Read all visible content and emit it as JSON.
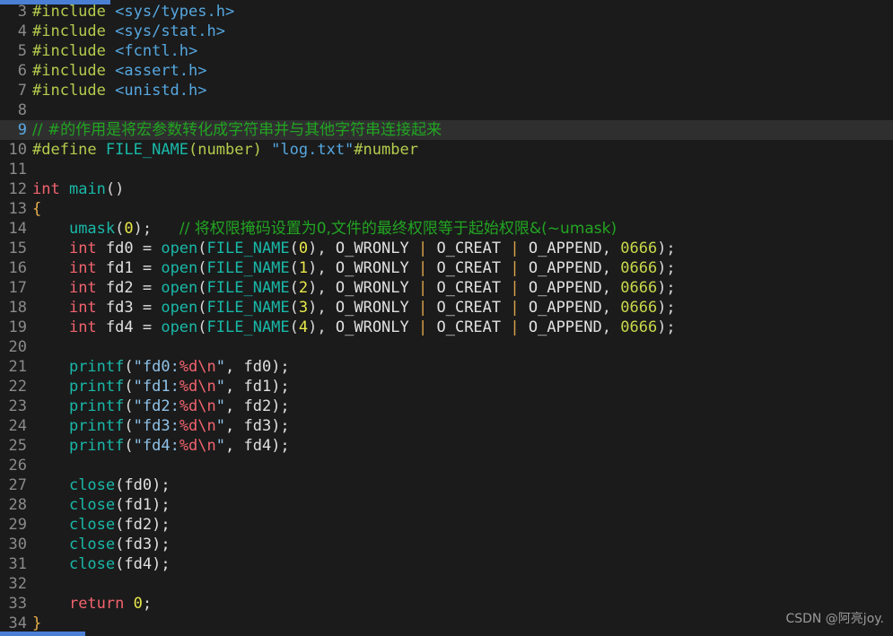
{
  "editor": {
    "background": "#1b1b1b",
    "active_line_background": "#2f2f2f",
    "gutter_color": "#8a8a8a",
    "active_gutter_color": "#5aa9e6",
    "scrollbar_color": "#4a7fd4",
    "first_visible_line": 3,
    "last_visible_line": 34,
    "active_line": 9
  },
  "watermark": {
    "text": "CSDN @阿亮joy."
  },
  "lines": [
    {
      "n": "3",
      "active": false,
      "tokens": [
        {
          "t": "#include",
          "c": "t-pre"
        },
        {
          "t": " ",
          "c": "t-plain"
        },
        {
          "t": "<sys/types.h>",
          "c": "t-header"
        }
      ]
    },
    {
      "n": "4",
      "active": false,
      "tokens": [
        {
          "t": "#include",
          "c": "t-pre"
        },
        {
          "t": " ",
          "c": "t-plain"
        },
        {
          "t": "<sys/stat.h>",
          "c": "t-header"
        }
      ]
    },
    {
      "n": "5",
      "active": false,
      "tokens": [
        {
          "t": "#include",
          "c": "t-pre"
        },
        {
          "t": " ",
          "c": "t-plain"
        },
        {
          "t": "<fcntl.h>",
          "c": "t-header"
        }
      ]
    },
    {
      "n": "6",
      "active": false,
      "tokens": [
        {
          "t": "#include",
          "c": "t-pre"
        },
        {
          "t": " ",
          "c": "t-plain"
        },
        {
          "t": "<assert.h>",
          "c": "t-header"
        }
      ]
    },
    {
      "n": "7",
      "active": false,
      "tokens": [
        {
          "t": "#include",
          "c": "t-pre"
        },
        {
          "t": " ",
          "c": "t-plain"
        },
        {
          "t": "<unistd.h>",
          "c": "t-header"
        }
      ]
    },
    {
      "n": "8",
      "active": false,
      "tokens": []
    },
    {
      "n": "9",
      "active": true,
      "tokens": [
        {
          "t": "// #的作用是将宏参数转化成字符串并与其他字符串连接起来",
          "c": "t-comment cjk"
        }
      ]
    },
    {
      "n": "10",
      "active": false,
      "tokens": [
        {
          "t": "#define",
          "c": "t-pre"
        },
        {
          "t": " ",
          "c": "t-plain"
        },
        {
          "t": "FILE_NAME",
          "c": "t-fn"
        },
        {
          "t": "(number)",
          "c": "t-pre"
        },
        {
          "t": " ",
          "c": "t-plain"
        },
        {
          "t": "\"log.txt\"",
          "c": "t-header"
        },
        {
          "t": "#number",
          "c": "t-pre"
        }
      ]
    },
    {
      "n": "11",
      "active": false,
      "tokens": []
    },
    {
      "n": "12",
      "active": false,
      "tokens": [
        {
          "t": "int",
          "c": "t-kw"
        },
        {
          "t": " ",
          "c": "t-plain"
        },
        {
          "t": "main",
          "c": "t-fn"
        },
        {
          "t": "()",
          "c": "t-punct"
        }
      ]
    },
    {
      "n": "13",
      "active": false,
      "tokens": [
        {
          "t": "{",
          "c": "t-brace"
        }
      ]
    },
    {
      "n": "14",
      "active": false,
      "tokens": [
        {
          "t": "    ",
          "c": "t-plain"
        },
        {
          "t": "umask",
          "c": "t-fn"
        },
        {
          "t": "(",
          "c": "t-punct"
        },
        {
          "t": "0",
          "c": "t-num"
        },
        {
          "t": ");",
          "c": "t-punct"
        },
        {
          "t": "   ",
          "c": "t-plain"
        },
        {
          "t": "// 将权限掩码设置为0,文件的最终权限等于起始权限&(~umask)",
          "c": "t-comment cjk"
        }
      ]
    },
    {
      "n": "15",
      "active": false,
      "tokens": [
        {
          "t": "    ",
          "c": "t-plain"
        },
        {
          "t": "int",
          "c": "t-kw"
        },
        {
          "t": " fd0 = ",
          "c": "t-plain"
        },
        {
          "t": "open",
          "c": "t-fn"
        },
        {
          "t": "(",
          "c": "t-punct"
        },
        {
          "t": "FILE_NAME",
          "c": "t-fn"
        },
        {
          "t": "(",
          "c": "t-punct"
        },
        {
          "t": "0",
          "c": "t-num"
        },
        {
          "t": "), ",
          "c": "t-punct"
        },
        {
          "t": "O_WRONLY",
          "c": "t-flag"
        },
        {
          "t": " | ",
          "c": "t-pipe"
        },
        {
          "t": "O_CREAT",
          "c": "t-flag"
        },
        {
          "t": " | ",
          "c": "t-pipe"
        },
        {
          "t": "O_APPEND",
          "c": "t-flag"
        },
        {
          "t": ", ",
          "c": "t-punct"
        },
        {
          "t": "0666",
          "c": "t-octal"
        },
        {
          "t": ");",
          "c": "t-punct"
        }
      ]
    },
    {
      "n": "16",
      "active": false,
      "tokens": [
        {
          "t": "    ",
          "c": "t-plain"
        },
        {
          "t": "int",
          "c": "t-kw"
        },
        {
          "t": " fd1 = ",
          "c": "t-plain"
        },
        {
          "t": "open",
          "c": "t-fn"
        },
        {
          "t": "(",
          "c": "t-punct"
        },
        {
          "t": "FILE_NAME",
          "c": "t-fn"
        },
        {
          "t": "(",
          "c": "t-punct"
        },
        {
          "t": "1",
          "c": "t-num"
        },
        {
          "t": "), ",
          "c": "t-punct"
        },
        {
          "t": "O_WRONLY",
          "c": "t-flag"
        },
        {
          "t": " | ",
          "c": "t-pipe"
        },
        {
          "t": "O_CREAT",
          "c": "t-flag"
        },
        {
          "t": " | ",
          "c": "t-pipe"
        },
        {
          "t": "O_APPEND",
          "c": "t-flag"
        },
        {
          "t": ", ",
          "c": "t-punct"
        },
        {
          "t": "0666",
          "c": "t-octal"
        },
        {
          "t": ");",
          "c": "t-punct"
        }
      ]
    },
    {
      "n": "17",
      "active": false,
      "tokens": [
        {
          "t": "    ",
          "c": "t-plain"
        },
        {
          "t": "int",
          "c": "t-kw"
        },
        {
          "t": " fd2 = ",
          "c": "t-plain"
        },
        {
          "t": "open",
          "c": "t-fn"
        },
        {
          "t": "(",
          "c": "t-punct"
        },
        {
          "t": "FILE_NAME",
          "c": "t-fn"
        },
        {
          "t": "(",
          "c": "t-punct"
        },
        {
          "t": "2",
          "c": "t-num"
        },
        {
          "t": "), ",
          "c": "t-punct"
        },
        {
          "t": "O_WRONLY",
          "c": "t-flag"
        },
        {
          "t": " | ",
          "c": "t-pipe"
        },
        {
          "t": "O_CREAT",
          "c": "t-flag"
        },
        {
          "t": " | ",
          "c": "t-pipe"
        },
        {
          "t": "O_APPEND",
          "c": "t-flag"
        },
        {
          "t": ", ",
          "c": "t-punct"
        },
        {
          "t": "0666",
          "c": "t-octal"
        },
        {
          "t": ");",
          "c": "t-punct"
        }
      ]
    },
    {
      "n": "18",
      "active": false,
      "tokens": [
        {
          "t": "    ",
          "c": "t-plain"
        },
        {
          "t": "int",
          "c": "t-kw"
        },
        {
          "t": " fd3 = ",
          "c": "t-plain"
        },
        {
          "t": "open",
          "c": "t-fn"
        },
        {
          "t": "(",
          "c": "t-punct"
        },
        {
          "t": "FILE_NAME",
          "c": "t-fn"
        },
        {
          "t": "(",
          "c": "t-punct"
        },
        {
          "t": "3",
          "c": "t-num"
        },
        {
          "t": "), ",
          "c": "t-punct"
        },
        {
          "t": "O_WRONLY",
          "c": "t-flag"
        },
        {
          "t": " | ",
          "c": "t-pipe"
        },
        {
          "t": "O_CREAT",
          "c": "t-flag"
        },
        {
          "t": " | ",
          "c": "t-pipe"
        },
        {
          "t": "O_APPEND",
          "c": "t-flag"
        },
        {
          "t": ", ",
          "c": "t-punct"
        },
        {
          "t": "0666",
          "c": "t-octal"
        },
        {
          "t": ");",
          "c": "t-punct"
        }
      ]
    },
    {
      "n": "19",
      "active": false,
      "tokens": [
        {
          "t": "    ",
          "c": "t-plain"
        },
        {
          "t": "int",
          "c": "t-kw"
        },
        {
          "t": " fd4 = ",
          "c": "t-plain"
        },
        {
          "t": "open",
          "c": "t-fn"
        },
        {
          "t": "(",
          "c": "t-punct"
        },
        {
          "t": "FILE_NAME",
          "c": "t-fn"
        },
        {
          "t": "(",
          "c": "t-punct"
        },
        {
          "t": "4",
          "c": "t-num"
        },
        {
          "t": "), ",
          "c": "t-punct"
        },
        {
          "t": "O_WRONLY",
          "c": "t-flag"
        },
        {
          "t": " | ",
          "c": "t-pipe"
        },
        {
          "t": "O_CREAT",
          "c": "t-flag"
        },
        {
          "t": " | ",
          "c": "t-pipe"
        },
        {
          "t": "O_APPEND",
          "c": "t-flag"
        },
        {
          "t": ", ",
          "c": "t-punct"
        },
        {
          "t": "0666",
          "c": "t-octal"
        },
        {
          "t": ");",
          "c": "t-punct"
        }
      ]
    },
    {
      "n": "20",
      "active": false,
      "tokens": []
    },
    {
      "n": "21",
      "active": false,
      "tokens": [
        {
          "t": "    ",
          "c": "t-plain"
        },
        {
          "t": "printf",
          "c": "t-fn"
        },
        {
          "t": "(",
          "c": "t-punct"
        },
        {
          "t": "\"fd0:",
          "c": "t-str"
        },
        {
          "t": "%d\\n",
          "c": "t-esc"
        },
        {
          "t": "\"",
          "c": "t-str"
        },
        {
          "t": ", fd0);",
          "c": "t-plain"
        }
      ]
    },
    {
      "n": "22",
      "active": false,
      "tokens": [
        {
          "t": "    ",
          "c": "t-plain"
        },
        {
          "t": "printf",
          "c": "t-fn"
        },
        {
          "t": "(",
          "c": "t-punct"
        },
        {
          "t": "\"fd1:",
          "c": "t-str"
        },
        {
          "t": "%d\\n",
          "c": "t-esc"
        },
        {
          "t": "\"",
          "c": "t-str"
        },
        {
          "t": ", fd1);",
          "c": "t-plain"
        }
      ]
    },
    {
      "n": "23",
      "active": false,
      "tokens": [
        {
          "t": "    ",
          "c": "t-plain"
        },
        {
          "t": "printf",
          "c": "t-fn"
        },
        {
          "t": "(",
          "c": "t-punct"
        },
        {
          "t": "\"fd2:",
          "c": "t-str"
        },
        {
          "t": "%d\\n",
          "c": "t-esc"
        },
        {
          "t": "\"",
          "c": "t-str"
        },
        {
          "t": ", fd2);",
          "c": "t-plain"
        }
      ]
    },
    {
      "n": "24",
      "active": false,
      "tokens": [
        {
          "t": "    ",
          "c": "t-plain"
        },
        {
          "t": "printf",
          "c": "t-fn"
        },
        {
          "t": "(",
          "c": "t-punct"
        },
        {
          "t": "\"fd3:",
          "c": "t-str"
        },
        {
          "t": "%d\\n",
          "c": "t-esc"
        },
        {
          "t": "\"",
          "c": "t-str"
        },
        {
          "t": ", fd3);",
          "c": "t-plain"
        }
      ]
    },
    {
      "n": "25",
      "active": false,
      "tokens": [
        {
          "t": "    ",
          "c": "t-plain"
        },
        {
          "t": "printf",
          "c": "t-fn"
        },
        {
          "t": "(",
          "c": "t-punct"
        },
        {
          "t": "\"fd4:",
          "c": "t-str"
        },
        {
          "t": "%d\\n",
          "c": "t-esc"
        },
        {
          "t": "\"",
          "c": "t-str"
        },
        {
          "t": ", fd4);",
          "c": "t-plain"
        }
      ]
    },
    {
      "n": "26",
      "active": false,
      "tokens": []
    },
    {
      "n": "27",
      "active": false,
      "tokens": [
        {
          "t": "    ",
          "c": "t-plain"
        },
        {
          "t": "close",
          "c": "t-fn"
        },
        {
          "t": "(fd0);",
          "c": "t-plain"
        }
      ]
    },
    {
      "n": "28",
      "active": false,
      "tokens": [
        {
          "t": "    ",
          "c": "t-plain"
        },
        {
          "t": "close",
          "c": "t-fn"
        },
        {
          "t": "(fd1);",
          "c": "t-plain"
        }
      ]
    },
    {
      "n": "29",
      "active": false,
      "tokens": [
        {
          "t": "    ",
          "c": "t-plain"
        },
        {
          "t": "close",
          "c": "t-fn"
        },
        {
          "t": "(fd2);",
          "c": "t-plain"
        }
      ]
    },
    {
      "n": "30",
      "active": false,
      "tokens": [
        {
          "t": "    ",
          "c": "t-plain"
        },
        {
          "t": "close",
          "c": "t-fn"
        },
        {
          "t": "(fd3);",
          "c": "t-plain"
        }
      ]
    },
    {
      "n": "31",
      "active": false,
      "tokens": [
        {
          "t": "    ",
          "c": "t-plain"
        },
        {
          "t": "close",
          "c": "t-fn"
        },
        {
          "t": "(fd4);",
          "c": "t-plain"
        }
      ]
    },
    {
      "n": "32",
      "active": false,
      "tokens": []
    },
    {
      "n": "33",
      "active": false,
      "tokens": [
        {
          "t": "    ",
          "c": "t-plain"
        },
        {
          "t": "return",
          "c": "t-kw"
        },
        {
          "t": " ",
          "c": "t-plain"
        },
        {
          "t": "0",
          "c": "t-num"
        },
        {
          "t": ";",
          "c": "t-punct"
        }
      ]
    },
    {
      "n": "34",
      "active": false,
      "tokens": [
        {
          "t": "}",
          "c": "t-brace"
        }
      ]
    }
  ]
}
